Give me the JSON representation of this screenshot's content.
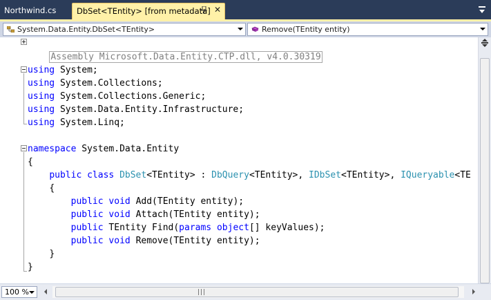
{
  "tabs": [
    {
      "label": "Northwind.cs",
      "active": false
    },
    {
      "label": "DbSet<TEntity> [from metadata]",
      "active": true
    }
  ],
  "tab_icons": {
    "pin": "pin-icon",
    "close": "close-icon",
    "dropdown": "tab-dropdown-icon"
  },
  "nav": {
    "type_combo": "System.Data.Entity.DbSet<TEntity>",
    "member_combo": "Remove(TEntity entity)"
  },
  "code": {
    "assembly": "Assembly Microsoft.Data.Entity.CTP.dll, v4.0.30319",
    "using_kw": "using",
    "usings": [
      "System;",
      "System.Collections;",
      "System.Collections.Generic;",
      "System.Data.Entity.Infrastructure;",
      "System.Linq;"
    ],
    "namespace_kw": "namespace",
    "namespace_name": "System.Data.Entity",
    "open_brace": "{",
    "close_brace": "}",
    "class_public": "public",
    "class_kw": "class",
    "class_name": "DbSet",
    "class_generic": "<TEntity> : ",
    "base1": "DbQuery",
    "base1_generic": "<TEntity>, ",
    "base2": "IDbSet",
    "base2_generic": "<TEntity>, ",
    "base3": "IQueryable",
    "base3_generic": "<TE",
    "m1_kw1": "public",
    "m1_kw2": "void",
    "m1_rest": "Add(TEntity entity);",
    "m2_kw1": "public",
    "m2_kw2": "void",
    "m2_rest": "Attach(TEntity entity);",
    "m3_kw1": "public",
    "m3_mid": "TEntity Find(",
    "m3_kw2": "params",
    "m3_kw3": "object",
    "m3_rest": "[] keyValues);",
    "m4_kw1": "public",
    "m4_kw2": "void",
    "m4_rest": "Remove(TEntity entity);"
  },
  "zoom": "100 %",
  "colors": {
    "keyword": "#0000ff",
    "type": "#2b91af",
    "tab_active": "#fff1a8",
    "chrome": "#2b3c59"
  }
}
